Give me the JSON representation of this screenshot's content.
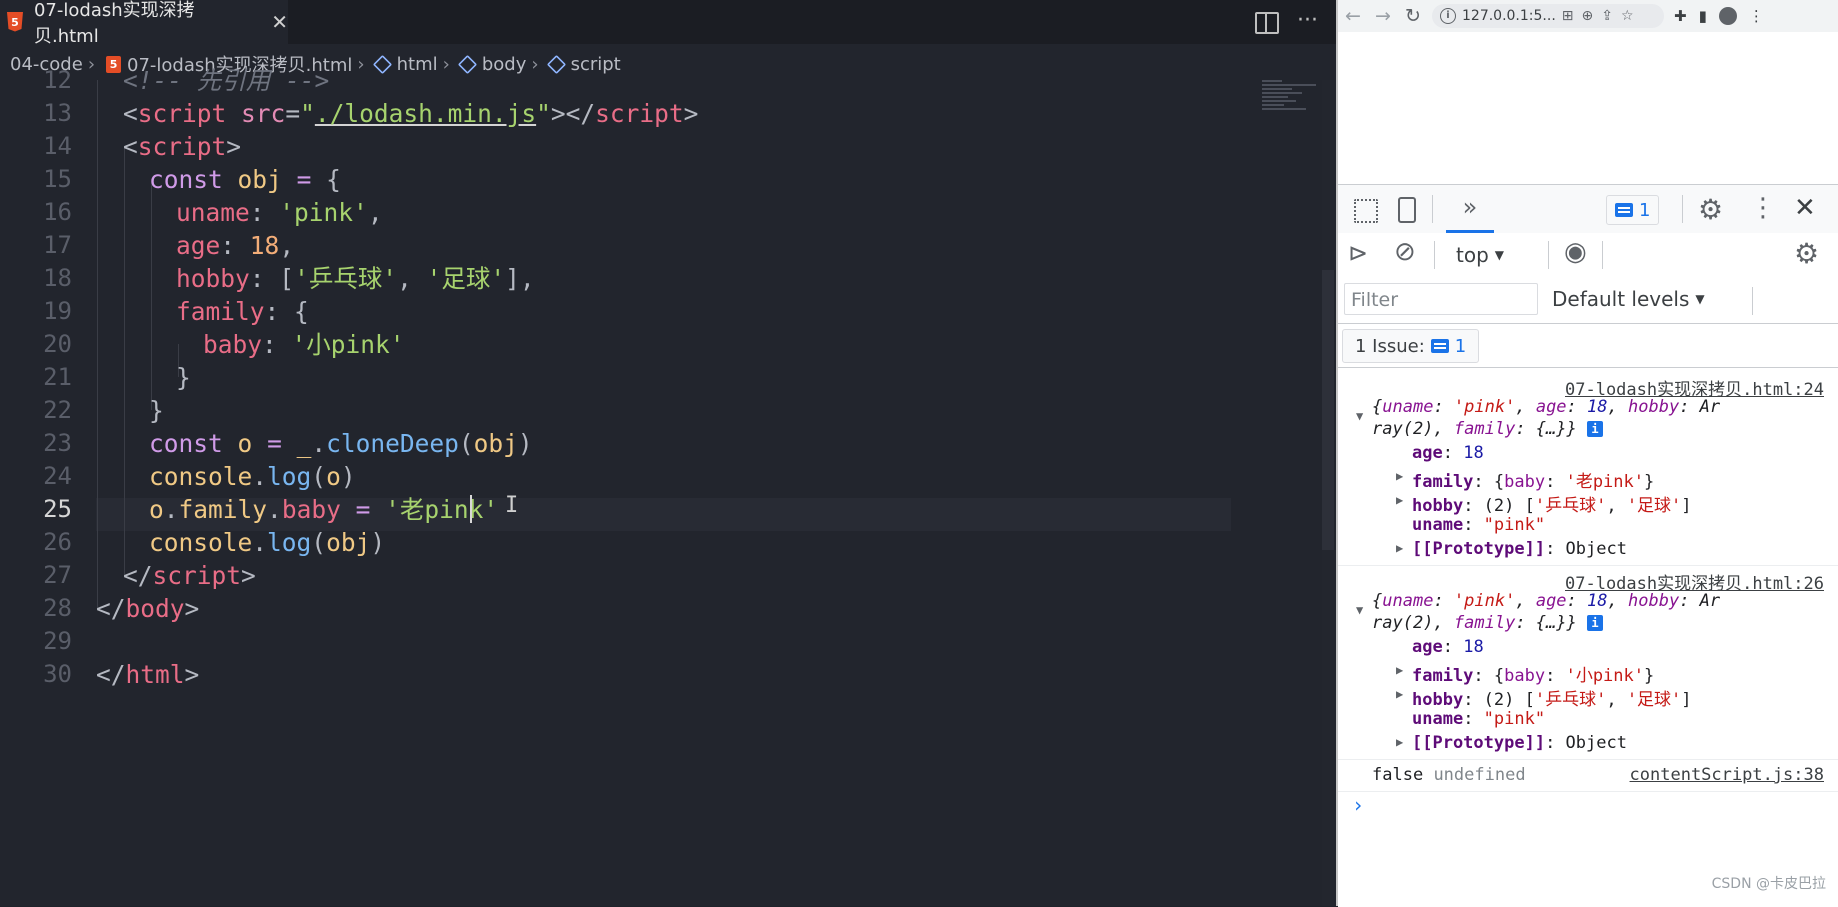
{
  "editor": {
    "tab_title": "07-lodash实现深拷贝.html",
    "tab_close": "✕",
    "breadcrumb": [
      "04-code",
      "07-lodash实现深拷贝.html",
      "html",
      "body",
      "script"
    ],
    "active_line": 25,
    "line_numbers": [
      "12",
      "13",
      "14",
      "15",
      "16",
      "17",
      "18",
      "19",
      "20",
      "21",
      "22",
      "23",
      "24",
      "25",
      "26",
      "27",
      "28",
      "29",
      "30"
    ]
  },
  "browser": {
    "url": "127.0.0.1:5...",
    "devtools": {
      "issue_count": "1",
      "context": "top",
      "filter_placeholder": "Filter",
      "levels": "Default levels",
      "issues_label": "1 Issue:",
      "issues_count": "1",
      "logs": [
        {
          "source": "07-lodash实现深拷贝.html:24",
          "family_baby": "'老pink'"
        },
        {
          "source": "07-lodash实现深拷贝.html:26",
          "family_baby": "'小pink'"
        }
      ],
      "result_line": "false",
      "result_undefined": "undefined",
      "result_source": "contentScript.js:38"
    }
  },
  "watermark": "CSDN @卡皮巴拉"
}
